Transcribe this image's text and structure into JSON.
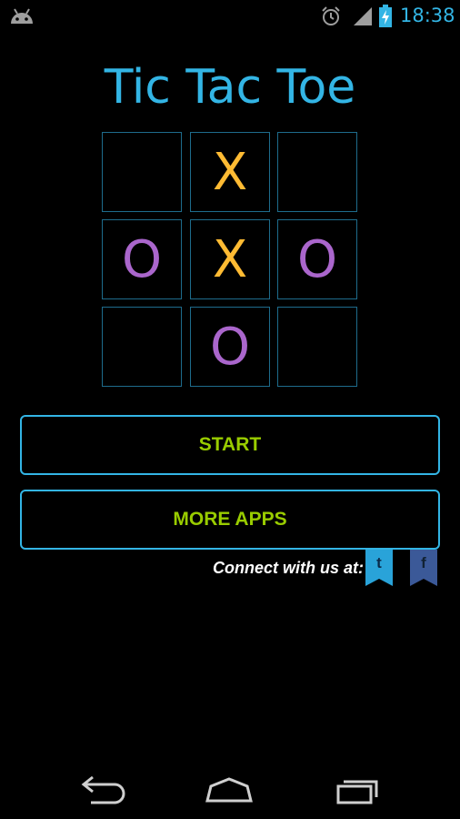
{
  "status_bar": {
    "time": "18:38",
    "icons": [
      "android-icon",
      "alarm-icon",
      "signal-icon",
      "battery-charging-icon"
    ]
  },
  "app": {
    "title": "Tic Tac Toe"
  },
  "board": {
    "cells": [
      "",
      "X",
      "",
      "O",
      "X",
      "O",
      "",
      "O",
      ""
    ]
  },
  "buttons": {
    "start": "START",
    "more_apps": "MORE APPS"
  },
  "connect": {
    "label": "Connect with us at:",
    "twitter_glyph": "t",
    "facebook_glyph": "f"
  },
  "colors": {
    "accent": "#33b5e5",
    "x_mark": "#ffbb33",
    "o_mark": "#aa66cc",
    "button_text": "#99cc00"
  },
  "nav_bar": {
    "icons": [
      "back-icon",
      "home-icon",
      "recent-apps-icon"
    ]
  }
}
